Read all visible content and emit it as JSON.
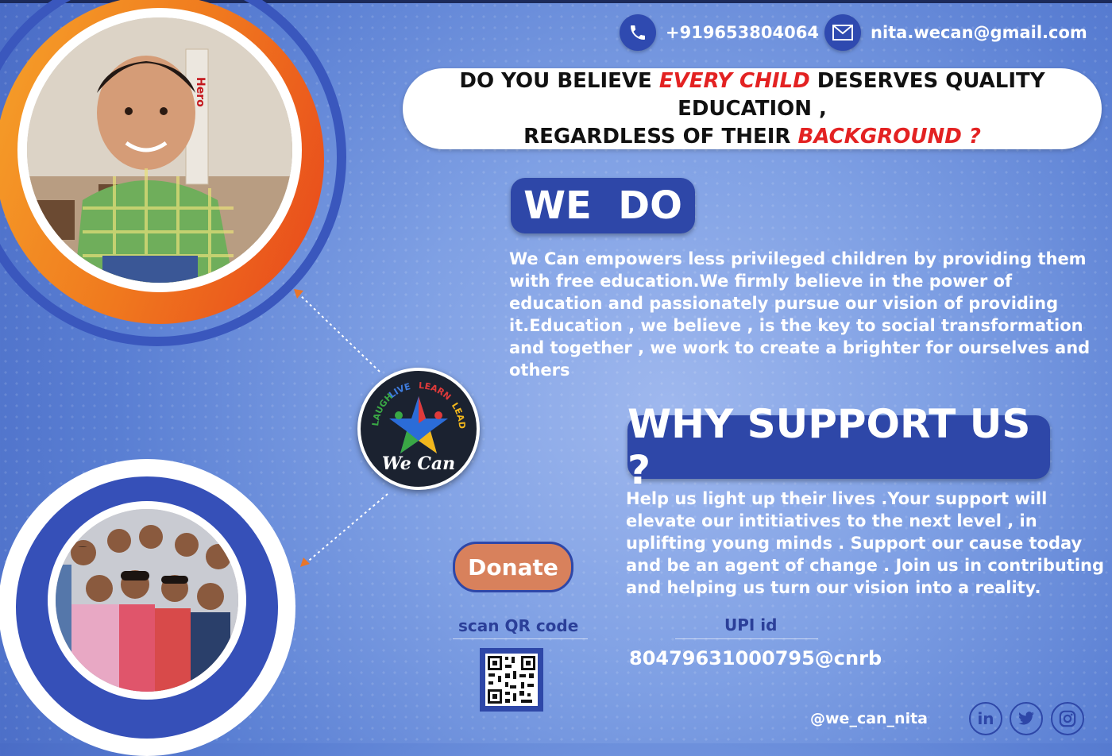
{
  "contact": {
    "phone": "+919653804064",
    "email": "nita.wecan@gmail.com"
  },
  "headline": {
    "line1_pre": "DO YOU BELIEVE ",
    "line1_highlight": "EVERY CHILD",
    "line1_post": " DESERVES QUALITY EDUCATION  ,",
    "line2_pre": "REGARDLESS OF THEIR ",
    "line2_highlight": "BACKGROUND ?"
  },
  "we_do": {
    "title": "WE  DO",
    "body_strong": "We Can",
    "body": " empowers less privileged children by providing them with free education.We firmly believe in the power of education and passionately pursue our vision of providing it.Education , we believe , is the key to social transformation and together , we work to create a brighter for ourselves and others"
  },
  "why": {
    "title": "WHY SUPPORT US ?",
    "body": "Help us light up their lives .Your support will elevate our  intitiatives to  the next  level , in uplifting  young minds . Support our cause  today and be an agent of change . Join us in contributing  and helping us turn our vision into a reality."
  },
  "logo": {
    "word_laugh": "LAUGH",
    "word_live": "LIVE",
    "word_learn": "LEARN",
    "word_lead": "LEAD",
    "name": "We Can"
  },
  "donate": {
    "button": "Donate",
    "qr_label": "scan QR code",
    "upi_label": "UPI id",
    "upi_id": "80479631000795@cnrb"
  },
  "social": {
    "handle": "@we_can_nita",
    "icons": [
      "linkedin-icon",
      "twitter-icon",
      "instagram-icon"
    ]
  },
  "photo_text": {
    "hero": "Hero"
  },
  "colors": {
    "accent_blue": "#2e47a8",
    "highlight_red": "#e32222",
    "donate_orange": "#d8815c",
    "ring_orange": "#f07a1e"
  }
}
